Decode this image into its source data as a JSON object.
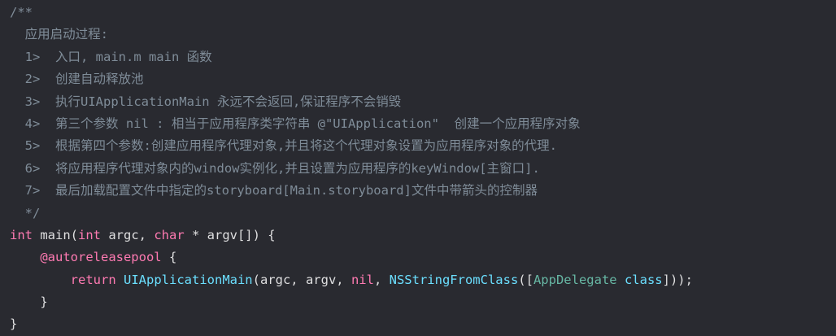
{
  "code": {
    "comment_open": "/**",
    "comment_title": "  应用启动过程:",
    "steps": [
      "  1>  入口, main.m main 函数",
      "  2>  创建自动释放池",
      "  3>  执行UIApplicationMain 永远不会返回,保证程序不会销毁",
      "  4>  第三个参数 nil : 相当于应用程序类字符串 @\"UIApplication\"  创建一个应用程序对象",
      "  5>  根据第四个参数:创建应用程序代理对象,并且将这个代理对象设置为应用程序对象的代理.",
      "  6>  将应用程序代理对象内的window实例化,并且设置为应用程序的keyWindow[主窗口].",
      "  7>  最后加载配置文件中指定的storyboard[Main.storyboard]文件中带箭头的控制器"
    ],
    "comment_close": "  */",
    "main_sig": {
      "kw_int": "int",
      "name": " main(",
      "kw_int2": "int",
      "argc": " argc, ",
      "kw_char": "char",
      "rest": " * argv[]) {"
    },
    "autorelease": {
      "indent": "    ",
      "kw": "@autoreleasepool",
      "brace": " {"
    },
    "return_line": {
      "indent": "        ",
      "kw_return": "return",
      "sp": " ",
      "func": "UIApplicationMain",
      "args": "(argc, argv, ",
      "kw_nil": "nil",
      "comma": ", ",
      "func2": "NSStringFromClass",
      "bracket": "([",
      "cls": "AppDelegate",
      "sp2": " ",
      "kw_class": "class",
      "end": "]));"
    },
    "inner_close": "    }",
    "outer_close": "}"
  }
}
